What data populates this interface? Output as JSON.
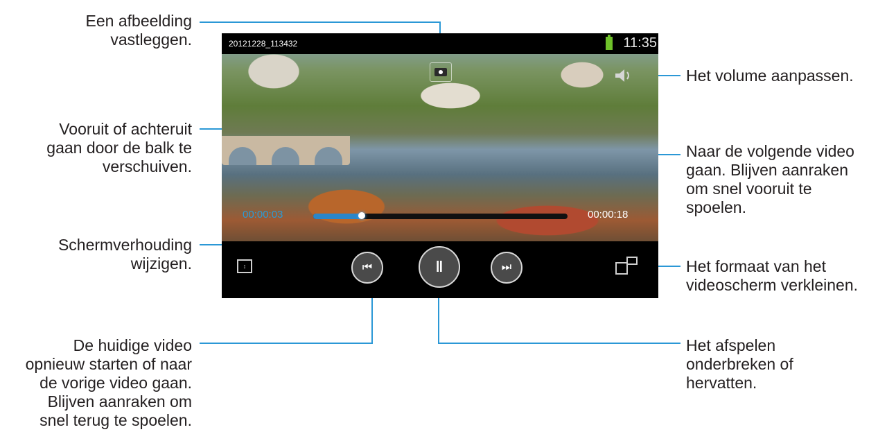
{
  "status_bar": {
    "filename": "20121228_113432",
    "clock": "11:35"
  },
  "player": {
    "elapsed_time": "00:00:03",
    "total_time": "00:00:18",
    "progress_fraction": 0.19
  },
  "icons": {
    "capture": "camera-icon",
    "volume": "speaker-icon",
    "aspect": "aspect-ratio-icon",
    "previous": "skip-previous-icon",
    "pause": "pause-icon",
    "next": "skip-next-icon",
    "popup": "popup-player-icon"
  },
  "colors": {
    "accent": "#2b98d6",
    "battery": "#6fc22a"
  },
  "callouts": {
    "capture": [
      "Een afbeelding",
      "vastleggen."
    ],
    "seek": [
      "Vooruit of achteruit",
      "gaan door de balk te",
      "verschuiven."
    ],
    "aspect": [
      "Schermverhouding",
      "wijzigen."
    ],
    "previous": [
      "De huidige video",
      "opnieuw starten of naar",
      "de vorige video gaan.",
      "Blijven aanraken om",
      "snel terug te spoelen."
    ],
    "volume": [
      "Het volume aanpassen."
    ],
    "next": [
      "Naar de volgende video",
      "gaan. Blijven aanraken",
      "om snel vooruit te",
      "spoelen."
    ],
    "popup": [
      "Het formaat van het",
      "videoscherm verkleinen."
    ],
    "pause": [
      "Het afspelen",
      "onderbreken of",
      "hervatten."
    ]
  }
}
